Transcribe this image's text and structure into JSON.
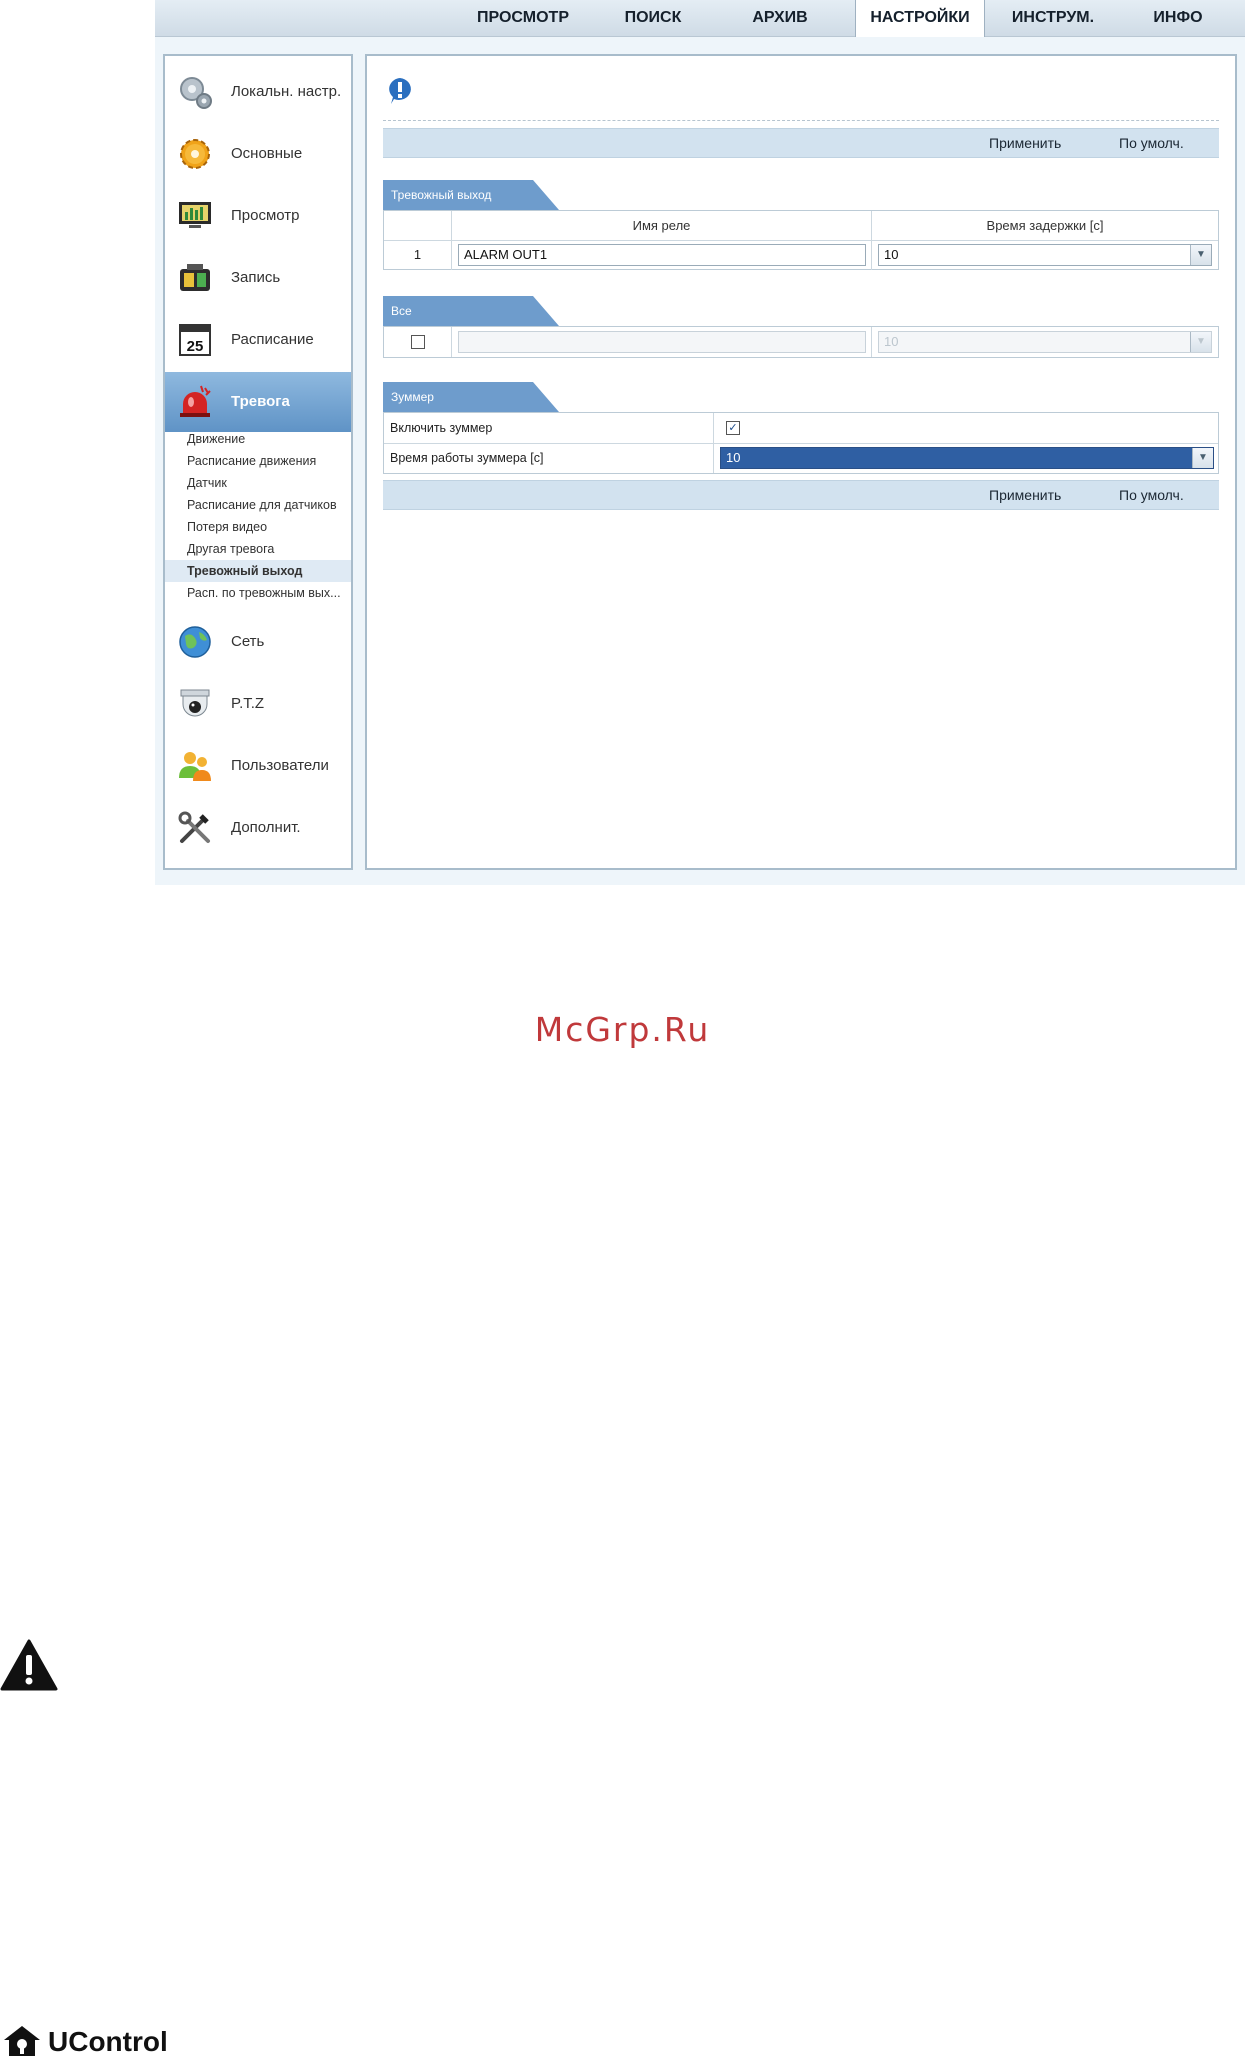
{
  "nav": {
    "tabs": [
      {
        "label": "ПРОСМОТР"
      },
      {
        "label": "ПОИСК"
      },
      {
        "label": "АРХИВ"
      },
      {
        "label": "НАСТРОЙКИ"
      },
      {
        "label": "ИНСТРУМ."
      },
      {
        "label": "ИНФО"
      }
    ],
    "active": "НАСТРОЙКИ"
  },
  "sidebar": {
    "items": [
      {
        "label": "Локальн. настр.",
        "icon": "local-settings-icon"
      },
      {
        "label": "Основные",
        "icon": "gear-icon"
      },
      {
        "label": "Просмотр",
        "icon": "monitor-icon"
      },
      {
        "label": "Запись",
        "icon": "record-icon"
      },
      {
        "label": "Расписание",
        "icon": "calendar-icon"
      },
      {
        "label": "Тревога",
        "icon": "alarm-siren-icon"
      },
      {
        "label": "Сеть",
        "icon": "globe-icon"
      },
      {
        "label": "P.T.Z",
        "icon": "ptz-camera-icon"
      },
      {
        "label": "Пользователи",
        "icon": "users-icon"
      },
      {
        "label": "Дополнит.",
        "icon": "tools-icon"
      }
    ],
    "calendar_day": "25",
    "submenu": [
      {
        "label": "Движение"
      },
      {
        "label": "Расписание движения"
      },
      {
        "label": "Датчик"
      },
      {
        "label": "Расписание для датчиков"
      },
      {
        "label": "Потеря видео"
      },
      {
        "label": "Другая тревога"
      },
      {
        "label": "Тревожный выход"
      },
      {
        "label": "Расп. по тревожным вых..."
      }
    ],
    "selected_sub": "Тревожный выход"
  },
  "main": {
    "apply_label": "Применить",
    "default_label": "По умолч.",
    "alarm_out": {
      "section_title": "Тревожный выход",
      "col_relay": "Имя реле",
      "col_delay": "Время задержки [c]",
      "rows": [
        {
          "num": "1",
          "relay_name": "ALARM OUT1",
          "delay": "10"
        }
      ]
    },
    "all": {
      "section_title": "Все",
      "relay_name": "",
      "delay": "10"
    },
    "buzzer": {
      "section_title": "Зуммер",
      "enable_label": "Включить зуммер",
      "enable_checked": true,
      "time_label": "Время работы зуммера [c]",
      "time_value": "10"
    }
  },
  "watermark": "McGrp.Ru",
  "brand": "UControl",
  "colors": {
    "accent": "#5f93c6",
    "bar": "#d2e2ef",
    "watermark": "#c0393b",
    "selected": "#2f5fa3"
  }
}
